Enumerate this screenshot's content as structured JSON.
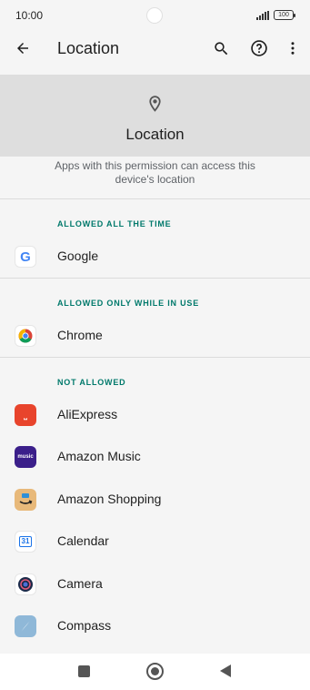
{
  "status_bar": {
    "time": "10:00",
    "battery": "100"
  },
  "app_bar": {
    "title": "Location"
  },
  "header": {
    "title": "Location"
  },
  "description": "Apps with this permission can access this device's location",
  "sections": [
    {
      "title": "ALLOWED ALL THE TIME",
      "apps": [
        "Google"
      ]
    },
    {
      "title": "ALLOWED ONLY WHILE IN USE",
      "apps": [
        "Chrome"
      ]
    },
    {
      "title": "NOT ALLOWED",
      "apps": [
        "AliExpress",
        "Amazon Music",
        "Amazon Shopping",
        "Calendar",
        "Camera",
        "Compass"
      ]
    }
  ],
  "icon_text": {
    "google": "G",
    "aliexpress": "⎵",
    "amazon_music": "music",
    "calendar": "31"
  },
  "icons": [
    "back-icon",
    "search-icon",
    "help-icon",
    "more-vert-icon",
    "location-pin-icon"
  ],
  "colors": {
    "accent": "#00796b",
    "header_bg": "#dedede",
    "background": "#f5f5f5"
  }
}
